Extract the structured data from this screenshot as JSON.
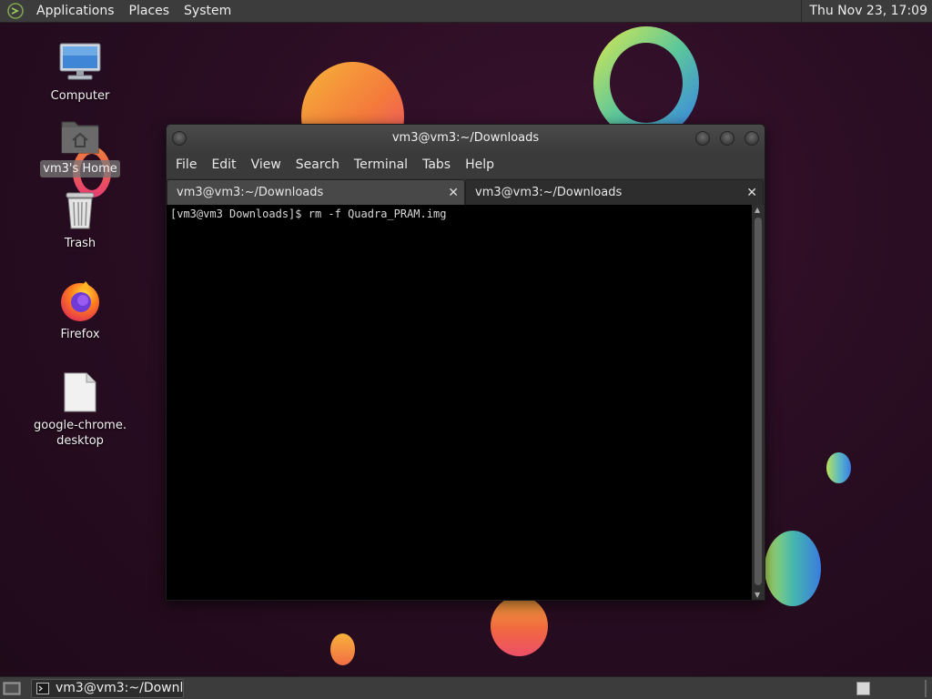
{
  "top_panel": {
    "menus": [
      "Applications",
      "Places",
      "System"
    ],
    "clock": "Thu Nov 23, 17:09"
  },
  "desktop": {
    "icons": [
      {
        "label": "Computer",
        "icon": "computer-icon"
      },
      {
        "label": "vm3's Home",
        "icon": "home-folder-icon",
        "selected": true
      },
      {
        "label": "Trash",
        "icon": "trash-icon"
      },
      {
        "label": "Firefox",
        "icon": "firefox-icon"
      },
      {
        "label": "google-chrome.\ndesktop",
        "icon": "file-icon"
      }
    ]
  },
  "window": {
    "title": "vm3@vm3:~/Downloads",
    "menu": [
      "File",
      "Edit",
      "View",
      "Search",
      "Terminal",
      "Tabs",
      "Help"
    ],
    "tabs": [
      {
        "label": "vm3@vm3:~/Downloads",
        "active": false
      },
      {
        "label": "vm3@vm3:~/Downloads",
        "active": true
      }
    ],
    "terminal_text": "[vm3@vm3 Downloads]$ rm -f Quadra_PRAM.img"
  },
  "bottom_panel": {
    "task_label": "vm3@vm3:~/Downl..."
  },
  "colors": {
    "desktop_bg": "#2a0d22",
    "panel_bg": "#3c3c3c",
    "terminal_bg": "#000000"
  }
}
